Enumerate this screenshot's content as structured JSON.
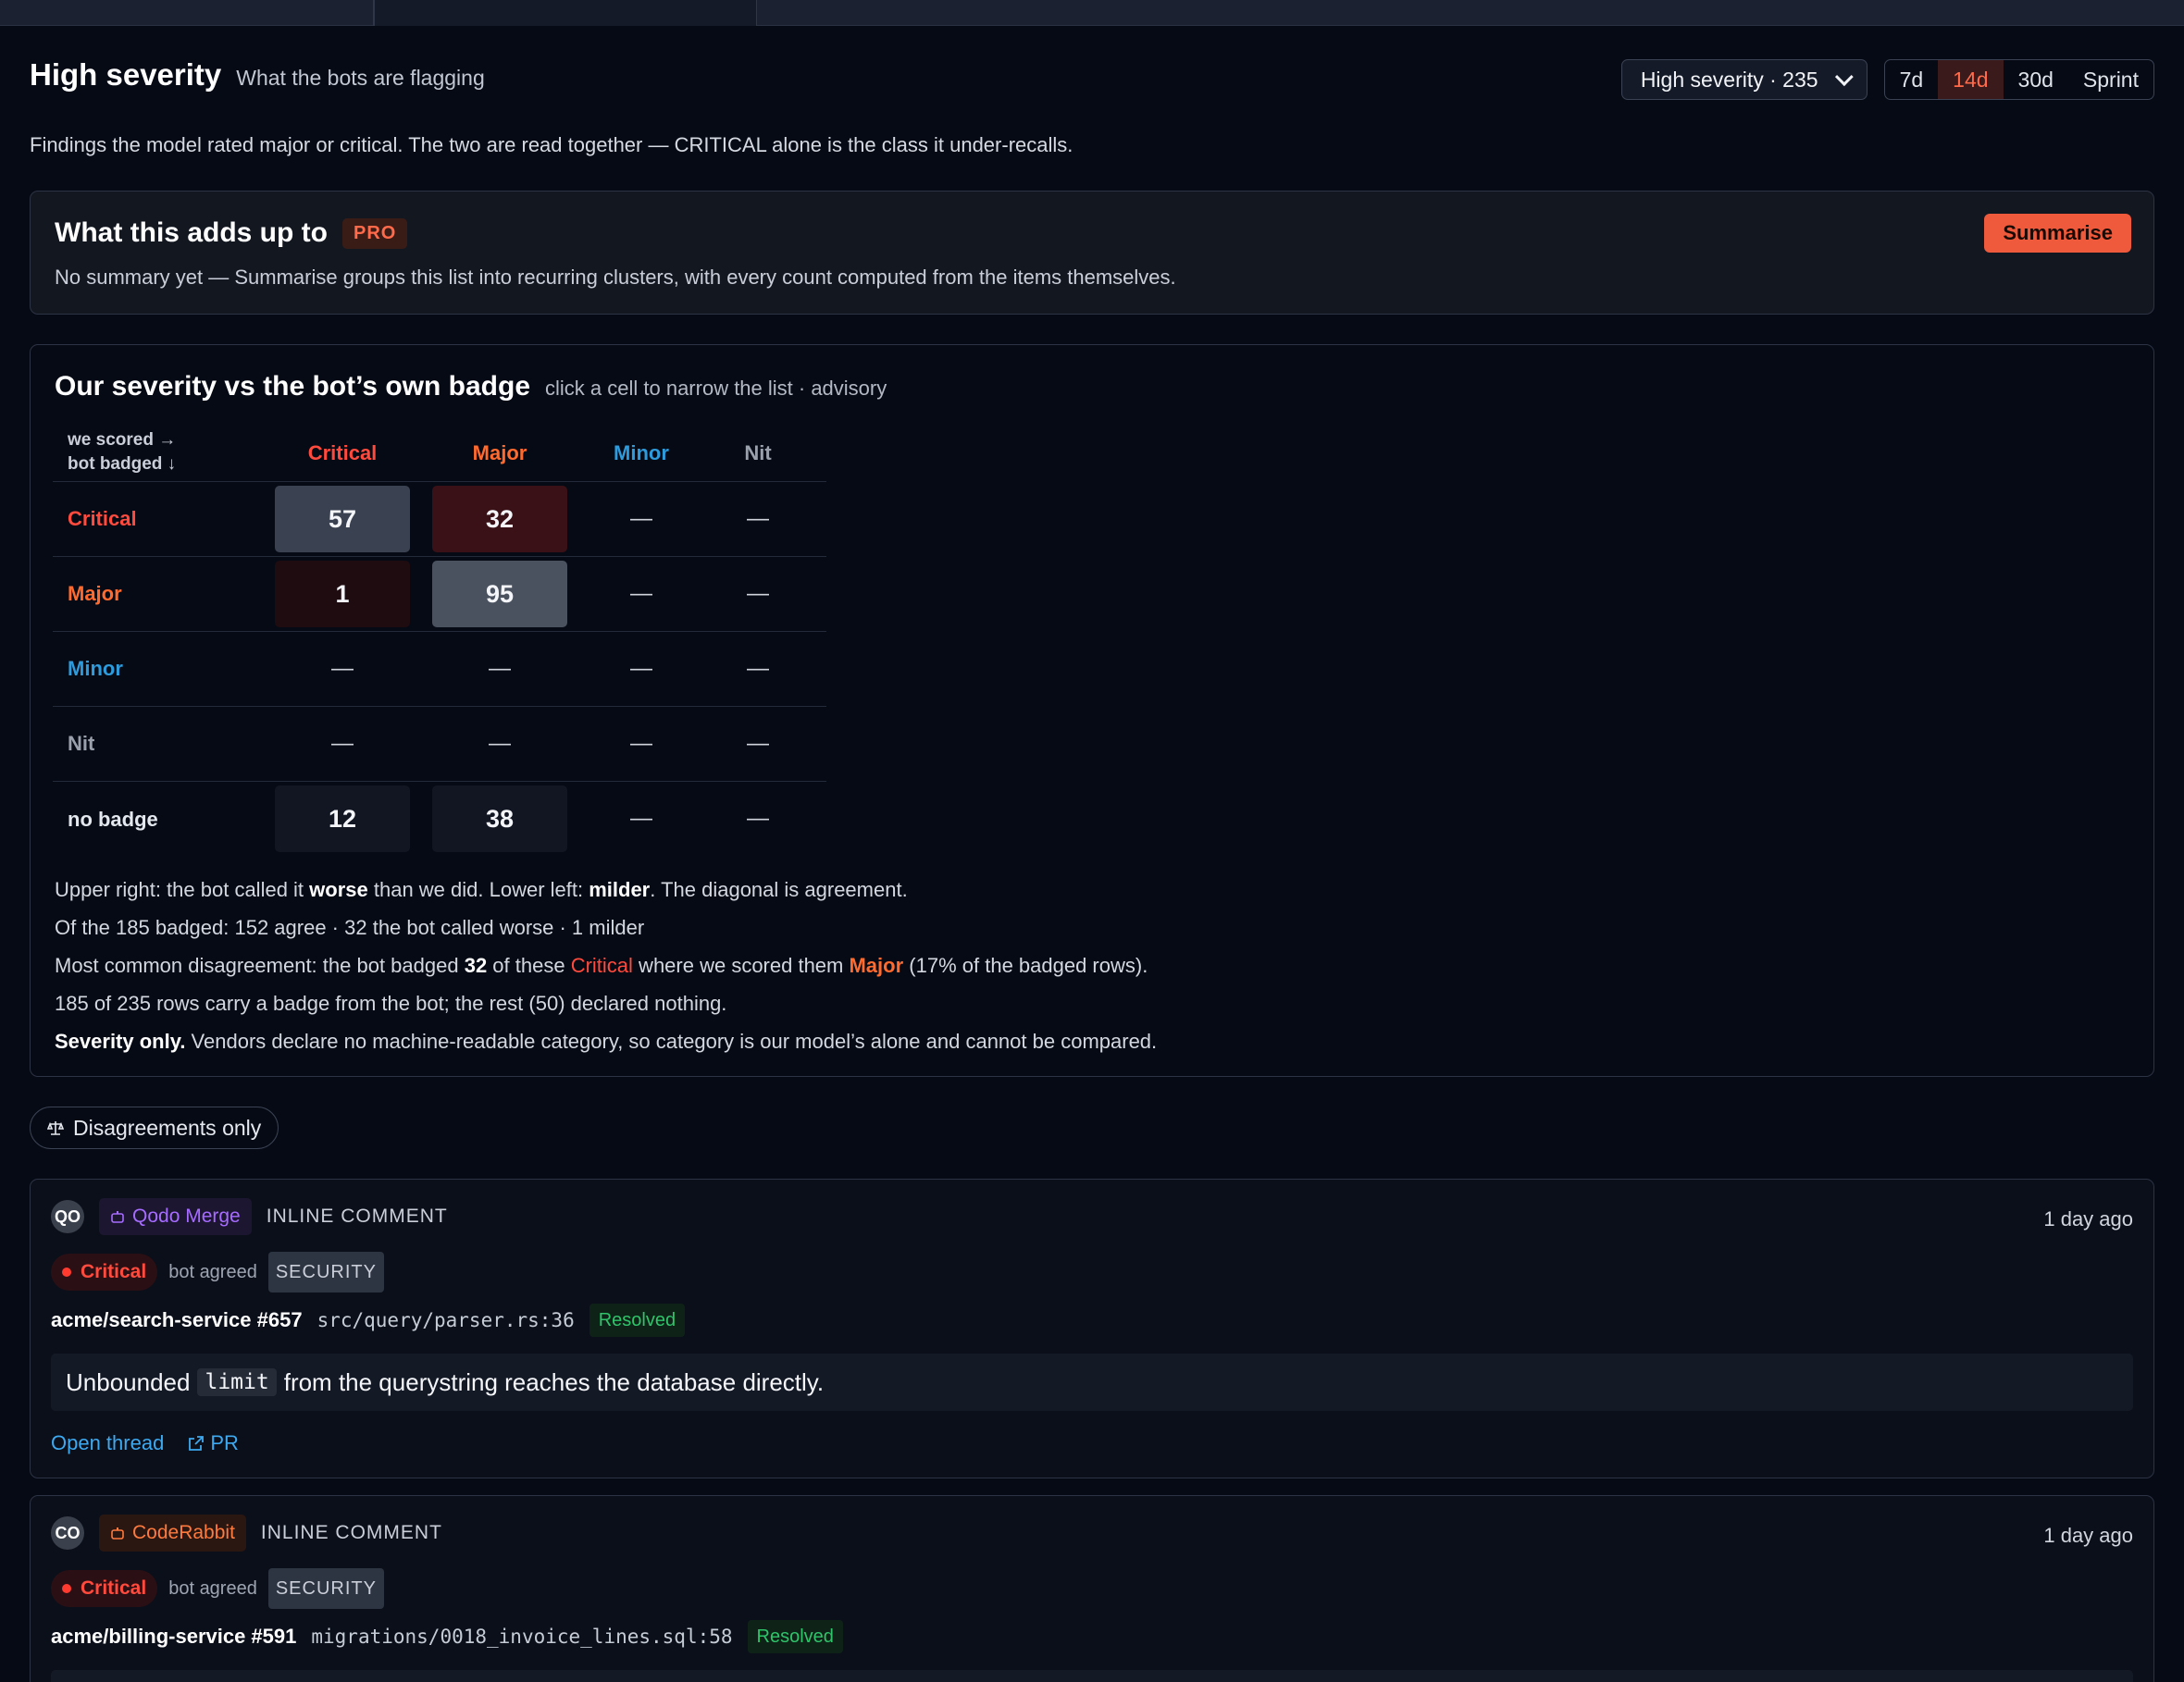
{
  "header": {
    "title": "High severity",
    "subtitle": "What the bots are flagging",
    "description": "Findings the model rated major or critical. The two are read together — CRITICAL alone is the class it under-recalls."
  },
  "controls": {
    "filter_select": "High severity · 235",
    "ranges": [
      "7d",
      "14d",
      "30d",
      "Sprint"
    ],
    "active_range": "14d"
  },
  "summary": {
    "title": "What this adds up to",
    "badge": "PRO",
    "text": "No summary yet — Summarise groups this list into recurring clusters, with every count computed from the items themselves.",
    "button": "Summarise"
  },
  "matrix": {
    "title": "Our severity vs the bot’s own badge",
    "hint": "click a cell to narrow the list · advisory",
    "axis_top": "we scored →",
    "axis_side": "bot badged ↓",
    "columns": [
      "Critical",
      "Major",
      "Minor",
      "Nit"
    ],
    "rows": [
      {
        "label": "Critical",
        "cells": [
          "57",
          "32",
          "—",
          "—"
        ]
      },
      {
        "label": "Major",
        "cells": [
          "1",
          "95",
          "—",
          "—"
        ]
      },
      {
        "label": "Minor",
        "cells": [
          "—",
          "—",
          "—",
          "—"
        ]
      },
      {
        "label": "Nit",
        "cells": [
          "—",
          "—",
          "—",
          "—"
        ]
      },
      {
        "label": "no badge",
        "cells": [
          "12",
          "38",
          "—",
          "—"
        ]
      }
    ],
    "notes": {
      "line1_a": "Upper right: the bot called it ",
      "line1_worse": "worse",
      "line1_b": " than we did. Lower left: ",
      "line1_milder": "milder",
      "line1_c": ". The diagonal is agreement.",
      "line2": "Of the 185 badged: 152 agree · 32 the bot called worse · 1 milder",
      "line3_a": "Most common disagreement: the bot badged ",
      "line3_num": "32",
      "line3_b": " of these ",
      "line3_crit": "Critical",
      "line3_c": " where we scored them ",
      "line3_major": "Major",
      "line3_d": " (17% of the badged rows).",
      "line4": "185 of 235 rows carry a badge from the bot; the rest (50) declared nothing.",
      "line5_bold": "Severity only.",
      "line5_rest": " Vendors declare no machine-readable category, so category is our model’s alone and cannot be compared."
    }
  },
  "filter_pill": {
    "label": "Disagreements only",
    "icon": "scale-icon"
  },
  "findings": [
    {
      "avatar": "QO",
      "bot": "Qodo Merge",
      "kind": "INLINE COMMENT",
      "time": "1 day ago",
      "severity": "Critical",
      "agreement": "bot agreed",
      "category": "SECURITY",
      "repo": "acme/search-service #657",
      "path": "src/query/parser.rs:36",
      "status": "Resolved",
      "body_a": "Unbounded",
      "body_code": "limit",
      "body_b": "from the querystring reaches the database directly.",
      "open_thread": "Open thread",
      "pr": "PR"
    },
    {
      "avatar": "CO",
      "bot": "CodeRabbit",
      "kind": "INLINE COMMENT",
      "time": "1 day ago",
      "severity": "Critical",
      "agreement": "bot agreed",
      "category": "SECURITY",
      "repo": "acme/billing-service #591",
      "path": "migrations/0018_invoice_lines.sql:58",
      "status": "Resolved"
    }
  ],
  "colors": {
    "background": "#060a14",
    "critical": "#ff4a3d",
    "major": "#ff6a2e",
    "minor": "#2d9bdc",
    "accent": "#ef5a3c",
    "resolved": "#2fc46a"
  }
}
